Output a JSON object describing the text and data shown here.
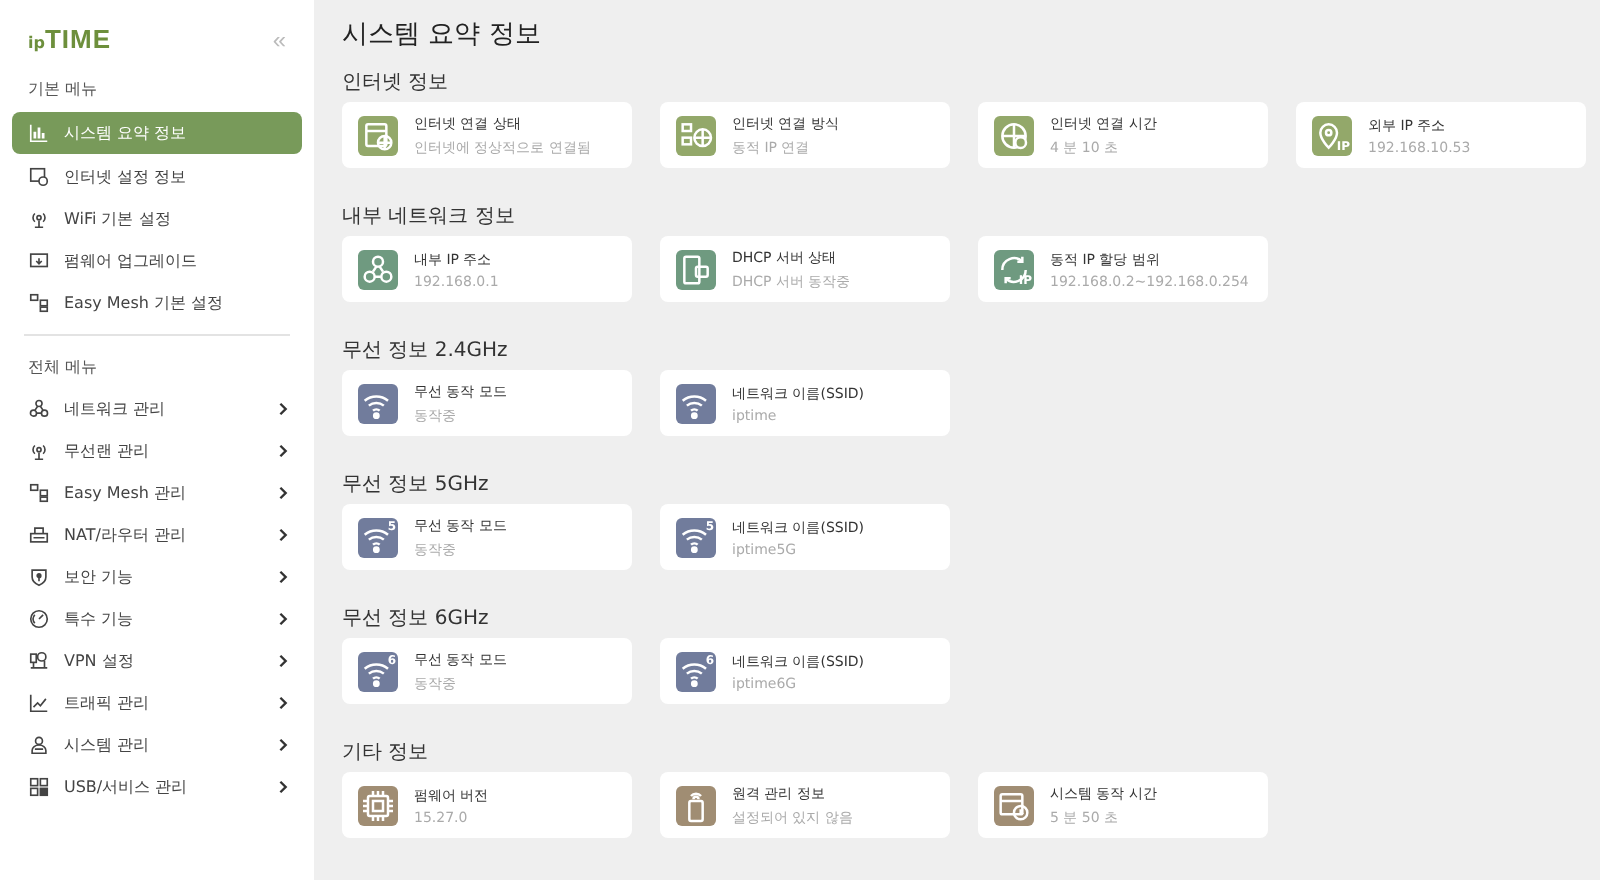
{
  "sidebar": {
    "logo": "ip**TIME**",
    "collapse": "«",
    "groups": [
      {
        "label": "기본 메뉴",
        "items": [
          {
            "label": "시스템 요약 정보",
            "kind": "link",
            "selected": true
          },
          {
            "label": "인터넷 설정 정보",
            "kind": "link",
            "selected": false
          },
          {
            "label": "WiFi 기본 설정",
            "kind": "link",
            "selected": false
          },
          {
            "label": "펌웨어 업그레이드",
            "kind": "link",
            "selected": false
          },
          {
            "label": "Easy Mesh 기본 설정",
            "kind": "link",
            "selected": false
          }
        ]
      },
      {
        "label": "전체 메뉴",
        "items": [
          {
            "label": "네트워크 관리",
            "kind": "submenu",
            "selected": false
          },
          {
            "label": "무선랜 관리",
            "kind": "submenu",
            "selected": false
          },
          {
            "label": "Easy Mesh 관리",
            "kind": "submenu",
            "selected": false
          },
          {
            "label": "NAT/라우터 관리",
            "kind": "submenu",
            "selected": false
          },
          {
            "label": "보안 기능",
            "kind": "submenu",
            "selected": false
          },
          {
            "label": "특수 기능",
            "kind": "submenu",
            "selected": false
          },
          {
            "label": "VPN 설정",
            "kind": "submenu",
            "selected": false
          },
          {
            "label": "트래픽 관리",
            "kind": "submenu",
            "selected": false
          },
          {
            "label": "시스템 관리",
            "kind": "submenu",
            "selected": false
          },
          {
            "label": "USB/서비스 관리",
            "kind": "submenu",
            "selected": false
          }
        ]
      }
    ]
  },
  "page_title": "시스템 요약 정보",
  "sections": [
    {
      "title": "인터넷 정보",
      "color": "#93a86a",
      "cards": [
        {
          "title": "인터넷 연결 상태",
          "value": "인터넷에 정상적으로 연결됨"
        },
        {
          "title": "인터넷 연결 방식",
          "value": "동적 IP 연결"
        },
        {
          "title": "인터넷 연결 시간",
          "value": "4 분 10 초"
        },
        {
          "icon_label": "IP",
          "title": "외부 IP 주소",
          "value": "192.168.10.53"
        }
      ]
    },
    {
      "title": "내부 네트워크 정보",
      "color": "#6f9a80",
      "cards": [
        {
          "title": "내부 IP 주소",
          "value": "192.168.0.1"
        },
        {
          "title": "DHCP 서버 상태",
          "value": "DHCP 서버 동작중"
        },
        {
          "icon_label": "IP",
          "title": "동적 IP 할당 범위",
          "value": "192.168.0.2~192.168.0.254"
        }
      ]
    },
    {
      "title": "무선 정보 2.4GHz",
      "color": "#717c9c",
      "cards": [
        {
          "title": "무선 동작 모드",
          "value": "동작중"
        },
        {
          "title": "네트워크 이름(SSID)",
          "value": "iptime"
        }
      ]
    },
    {
      "title": "무선 정보 5GHz",
      "color": "#717c9c",
      "cards": [
        {
          "icon_label": "5",
          "title": "무선 동작 모드",
          "value": "동작중"
        },
        {
          "icon_label": "5",
          "title": "네트워크 이름(SSID)",
          "value": "iptime5G"
        }
      ]
    },
    {
      "title": "무선 정보 6GHz",
      "color": "#717c9c",
      "cards": [
        {
          "icon_label": "6",
          "title": "무선 동작 모드",
          "value": "동작중"
        },
        {
          "icon_label": "6",
          "title": "네트워크 이름(SSID)",
          "value": "iptime6G"
        }
      ]
    },
    {
      "title": "기타 정보",
      "color": "#a08d73",
      "cards": [
        {
          "title": "펌웨어 버전",
          "value": "15.27.0"
        },
        {
          "title": "원격 관리 정보",
          "value": "설정되어 있지 않음"
        },
        {
          "title": "시스템 동작 시간",
          "value": "5 분 50 초"
        }
      ]
    }
  ]
}
